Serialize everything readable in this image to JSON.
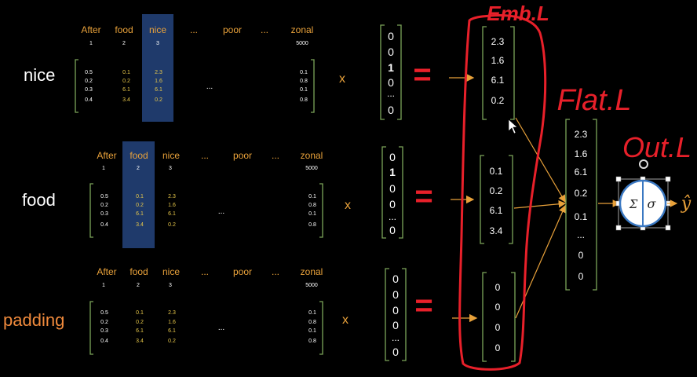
{
  "colors": {
    "background": "#000000",
    "word_label": "#ffffff",
    "padding_label": "#f08a3c",
    "header_text": "#e8a13a",
    "highlight_column": "#1f3a6b",
    "bracket_green": "#7ca55a",
    "matrix_values_highlight": "#e8c84a",
    "arrow": "#e8a13a",
    "hand_annotation": "#e8202a"
  },
  "embedding_rows": [
    {
      "word": "nice",
      "word_is_padding": false,
      "headers": [
        "After",
        "food",
        "nice",
        "...",
        "poor",
        "...",
        "zonal"
      ],
      "indices": [
        "1",
        "2",
        "3",
        "",
        "",
        "",
        "5000"
      ],
      "highlight_index": 2,
      "col1": [
        "0.5",
        "0.2",
        "0.3",
        "0.4"
      ],
      "col2": [
        "0.1",
        "0.2",
        "6.1",
        "3.4"
      ],
      "col3": [
        "2.3",
        "1.6",
        "6.1",
        "0.2"
      ],
      "ellipsis": "...",
      "col_last": [
        "0.1",
        "0.8",
        "0.1",
        "0.8"
      ],
      "times": "x",
      "onehot": [
        "0",
        "0",
        "1",
        "0",
        "...",
        "0"
      ],
      "equals": "=",
      "vector": [
        "2.3",
        "1.6",
        "6.1",
        "0.2"
      ]
    },
    {
      "word": "food",
      "word_is_padding": false,
      "headers": [
        "After",
        "food",
        "nice",
        "...",
        "poor",
        "...",
        "zonal"
      ],
      "indices": [
        "1",
        "2",
        "3",
        "",
        "",
        "",
        "5000"
      ],
      "highlight_index": 1,
      "col1": [
        "0.5",
        "0.2",
        "0.3",
        "0.4"
      ],
      "col2": [
        "0.1",
        "0.2",
        "6.1",
        "3.4"
      ],
      "col3": [
        "2.3",
        "1.6",
        "6.1",
        "0.2"
      ],
      "ellipsis": "...",
      "col_last": [
        "0.1",
        "0.8",
        "0.1",
        "0.8"
      ],
      "times": "x",
      "onehot": [
        "0",
        "1",
        "0",
        "0",
        "...",
        "0"
      ],
      "equals": "=",
      "vector": [
        "0.1",
        "0.2",
        "6.1",
        "3.4"
      ]
    },
    {
      "word": "padding",
      "word_is_padding": true,
      "headers": [
        "After",
        "food",
        "nice",
        "...",
        "poor",
        "...",
        "zonal"
      ],
      "indices": [
        "1",
        "2",
        "3",
        "",
        "",
        "",
        "5000"
      ],
      "highlight_index": -1,
      "col1": [
        "0.5",
        "0.2",
        "0.3",
        "0.4"
      ],
      "col2": [
        "0.1",
        "0.2",
        "6.1",
        "3.4"
      ],
      "col3": [
        "2.3",
        "1.6",
        "6.1",
        "0.2"
      ],
      "ellipsis": "...",
      "col_last": [
        "0.1",
        "0.8",
        "0.1",
        "0.8"
      ],
      "times": "x",
      "onehot": [
        "0",
        "0",
        "0",
        "0",
        "...",
        "0"
      ],
      "equals": "=",
      "vector": [
        "0",
        "0",
        "0",
        "0"
      ]
    }
  ],
  "flatten_vector": [
    "2.3",
    "1.6",
    "6.1",
    "0.2",
    "0.1",
    "...",
    "0",
    "0"
  ],
  "output_node": {
    "sum": "Σ",
    "activation": "σ",
    "output": "ŷ"
  },
  "annotations": {
    "embedding_layer": "Emb.L",
    "flatten_layer": "Flat.L",
    "output_layer": "Out.L"
  }
}
